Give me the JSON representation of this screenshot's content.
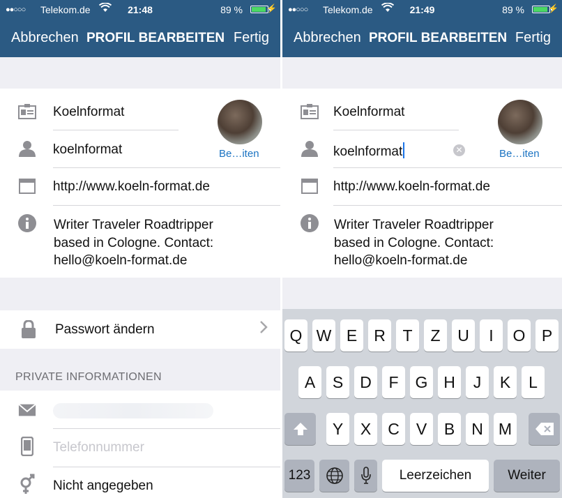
{
  "left": {
    "status": {
      "carrier": "Telekom.de",
      "time": "21:48",
      "battery": "89 %",
      "battery_fraction": 0.89
    },
    "nav": {
      "cancel": "Abbrechen",
      "title": "PROFIL BEARBEITEN",
      "done": "Fertig"
    },
    "profile": {
      "name": "Koelnformat",
      "username": "koelnformat",
      "website": "http://www.koeln-format.de",
      "bio_lines": [
        "Writer Traveler Roadtripper",
        "based in Cologne. Contact:",
        "hello@koeln-format.de"
      ],
      "photo_label": "Be…iten"
    },
    "password_row": "Passwort ändern",
    "private_header": "PRIVATE INFORMATIONEN",
    "phone_placeholder": "Telefonnummer",
    "gender": "Nicht angegeben"
  },
  "right": {
    "status": {
      "carrier": "Telekom.de",
      "time": "21:49",
      "battery": "89 %",
      "battery_fraction": 0.89
    },
    "nav": {
      "cancel": "Abbrechen",
      "title": "PROFIL BEARBEITEN",
      "done": "Fertig"
    },
    "profile": {
      "name": "Koelnformat",
      "username": "koelnformat",
      "website": "http://www.koeln-format.de",
      "bio_lines": [
        "Writer Traveler Roadtripper",
        "based in Cologne. Contact:",
        "hello@koeln-format.de"
      ],
      "photo_label": "Be…iten"
    },
    "keyboard": {
      "row1": [
        "Q",
        "W",
        "E",
        "R",
        "T",
        "Z",
        "U",
        "I",
        "O",
        "P"
      ],
      "row2": [
        "A",
        "S",
        "D",
        "F",
        "G",
        "H",
        "J",
        "K",
        "L"
      ],
      "row3": [
        "Y",
        "X",
        "C",
        "V",
        "B",
        "N",
        "M"
      ],
      "numbers": "123",
      "space": "Leerzeichen",
      "return": "Weiter"
    }
  },
  "icons": [
    "id-card-icon",
    "person-icon",
    "browser-icon",
    "info-icon",
    "lock-icon",
    "mail-icon",
    "phone-icon",
    "gender-icon",
    "chevron-right-icon",
    "clear-icon",
    "shift-icon",
    "delete-icon",
    "globe-icon",
    "microphone-icon"
  ]
}
